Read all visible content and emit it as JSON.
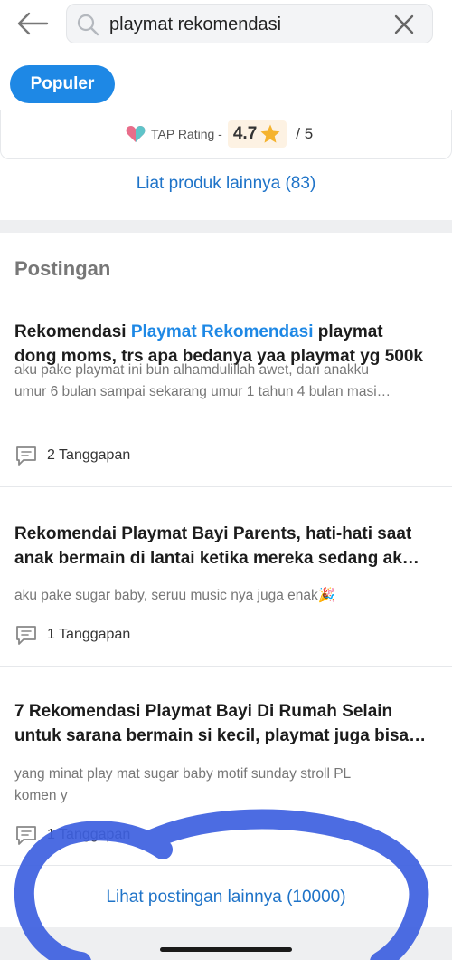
{
  "header": {
    "search_query": "playmat rekomendasi",
    "back_icon": "arrow-left-icon",
    "clear_icon": "close-icon"
  },
  "filter": {
    "active_pill": "Populer"
  },
  "product": {
    "rating_label": "TAP Rating -",
    "rating_value": "4.7",
    "rating_max": "/ 5",
    "see_more": "Liat produk lainnya (83)"
  },
  "posts_section": {
    "title": "Postingan",
    "posts": [
      {
        "title_prefix": "Rekomendasi ",
        "title_highlight": "Playmat Rekomendasi",
        "title_suffix": " playmat",
        "title_line2": "dong moms, trs apa bedanya yaa playmat yg 500k",
        "snippet_line1": "aku pake playmat ini bun alhamdulillah awet, dari anakku",
        "snippet_line2": "umur 6 bulan sampai sekarang umur 1 tahun 4 bulan masi…",
        "replies": "2 Tanggapan"
      },
      {
        "title_line1": "Rekomendai Playmat Bayi Parents, hati-hati saat",
        "title_line2": "anak bermain di lantai ketika mereka sedang ak…",
        "snippet_line1": "aku pake sugar baby, seruu music nya juga enak🎉",
        "replies": "1 Tanggapan"
      },
      {
        "title_line1": "7 Rekomendasi Playmat Bayi Di Rumah Selain",
        "title_line2": "untuk sarana bermain si kecil, playmat juga bisa…",
        "snippet_line1": "yang minat play mat sugar baby motif sunday stroll PL",
        "snippet_line2": "komen y",
        "replies": "1 Tanggapan"
      }
    ],
    "see_more": "Lihat postingan lainnya (10000)"
  },
  "colors": {
    "accent": "#1e88e5",
    "link": "#1e73c8",
    "annotation": "#3d5fe0"
  }
}
